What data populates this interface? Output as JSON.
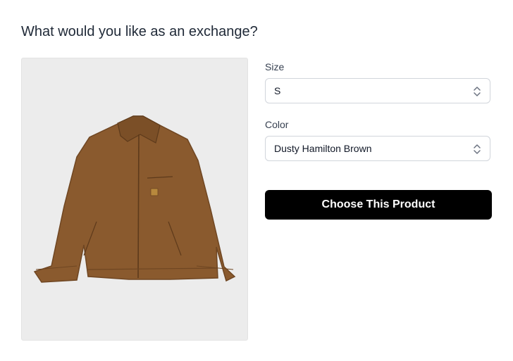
{
  "heading": "What would you like as an exchange?",
  "product": {
    "image_icon": "jacket-image",
    "image_bg": "#ececec",
    "jacket_color": "#8a5a2e"
  },
  "size": {
    "label": "Size",
    "value": "S"
  },
  "color": {
    "label": "Color",
    "value": "Dusty Hamilton Brown"
  },
  "cta": {
    "label": "Choose This Product",
    "bg": "#000000"
  }
}
